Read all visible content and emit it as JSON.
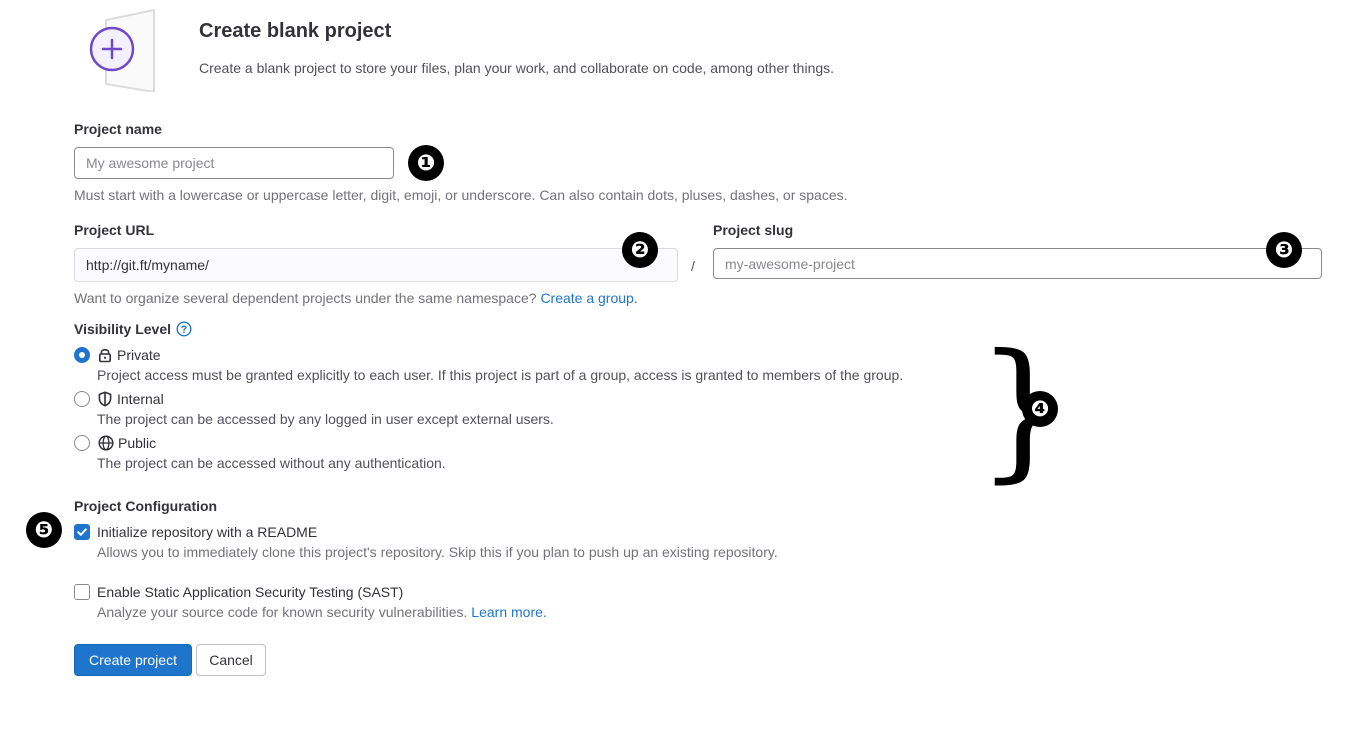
{
  "header": {
    "title": "Create blank project",
    "description": "Create a blank project to store your files, plan your work, and collaborate on code, among other things.",
    "illustration_icon": "plus-icon"
  },
  "project_name": {
    "label": "Project name",
    "placeholder": "My awesome project",
    "value": "",
    "help": "Must start with a lowercase or uppercase letter, digit, emoji, or underscore. Can also contain dots, pluses, dashes, or spaces."
  },
  "project_url": {
    "label": "Project URL",
    "value": "http://git.ft/myname/",
    "separator": "/"
  },
  "project_slug": {
    "label": "Project slug",
    "placeholder": "my-awesome-project",
    "value": ""
  },
  "namespace_help": {
    "text": "Want to organize several dependent projects under the same namespace?",
    "link": "Create a group."
  },
  "visibility": {
    "label": "Visibility Level",
    "help_icon": "question-circle-icon",
    "selected": "Private",
    "options": [
      {
        "label": "Private",
        "icon": "lock-icon",
        "description": "Project access must be granted explicitly to each user. If this project is part of a group, access is granted to members of the group.",
        "checked": true
      },
      {
        "label": "Internal",
        "icon": "shield-icon",
        "description": "The project can be accessed by any logged in user except external users.",
        "checked": false
      },
      {
        "label": "Public",
        "icon": "globe-icon",
        "description": "The project can be accessed without any authentication.",
        "checked": false
      }
    ]
  },
  "configuration": {
    "label": "Project Configuration",
    "options": [
      {
        "label": "Initialize repository with a README",
        "description": "Allows you to immediately clone this project's repository. Skip this if you plan to push up an existing repository.",
        "checked": true
      },
      {
        "label": "Enable Static Application Security Testing (SAST)",
        "description": "Analyze your source code for known security vulnerabilities.",
        "link": "Learn more.",
        "checked": false
      }
    ]
  },
  "actions": {
    "create": "Create project",
    "cancel": "Cancel"
  },
  "annotations": {
    "badges": [
      "❶",
      "❷",
      "❸",
      "❹",
      "❺"
    ],
    "brace": "}"
  },
  "colors": {
    "accent": "#1f75cb",
    "illustration_purple": "#6e49cb",
    "text": "#333238",
    "muted_text": "#737278"
  }
}
